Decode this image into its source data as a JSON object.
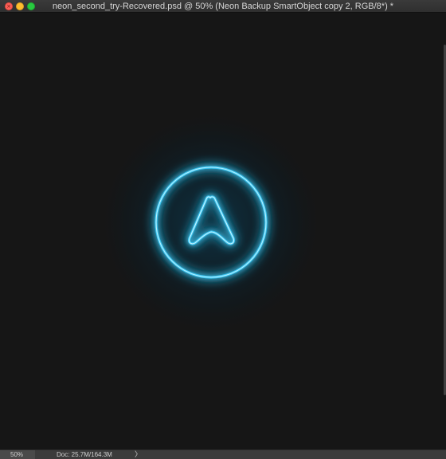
{
  "window": {
    "title": "neon_second_try-Recovered.psd @ 50% (Neon Backup SmartObject copy 2, RGB/8*) *",
    "controls": {
      "close_glyph": "×",
      "close_color": "#fc5f57",
      "minimize_color": "#fdbd2e",
      "zoom_color": "#28c940"
    }
  },
  "canvas": {
    "background_color": "#161616",
    "neon_color": "#4fd8ff",
    "glow_color": "#1aa7e6",
    "artwork": "neon-navigation-arrow-in-circle"
  },
  "statusbar": {
    "zoom_level": "50%",
    "doc_info": "Doc: 25.7M/164.3M",
    "arrow_glyph": "〉"
  }
}
